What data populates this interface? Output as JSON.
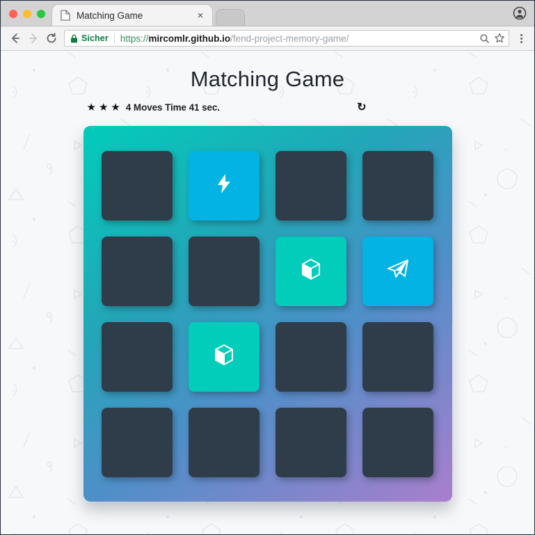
{
  "browser": {
    "traffic_lights": [
      "close",
      "minimize",
      "zoom"
    ],
    "tab": {
      "title": "Matching Game",
      "favicon": "page-icon",
      "close_label": "×"
    },
    "toolbar": {
      "back": "←",
      "forward": "→",
      "reload": "C",
      "security_label": "Sicher",
      "url_scheme": "https://",
      "url_host": "mircomlr.github.io",
      "url_path": "/fend-project-memory-game/",
      "zoom_icon": "search-icon",
      "bookmark_icon": "star-icon",
      "menu_icon": "three-dot-menu-icon",
      "profile_icon": "account-avatar-icon"
    }
  },
  "page": {
    "title": "Matching Game",
    "score": {
      "stars": 3,
      "star_glyph": "★",
      "moves_text": "4 Moves Time 41 sec.",
      "moves": 4,
      "time_seconds": 41,
      "restart_glyph": "↻",
      "restart_label": "restart-button"
    },
    "board": {
      "rows": 4,
      "columns": 4,
      "colors": {
        "card_back": "#2e3d49",
        "card_open": "#02b3e4",
        "card_match": "#02ccba",
        "deck_gradient_start": "#02ccba",
        "deck_gradient_mid": "#4e8fc9",
        "deck_gradient_end": "#aa7ecd"
      },
      "cards": [
        {
          "state": "closed",
          "icon": ""
        },
        {
          "state": "open",
          "icon": "bolt-icon"
        },
        {
          "state": "closed",
          "icon": ""
        },
        {
          "state": "closed",
          "icon": ""
        },
        {
          "state": "closed",
          "icon": ""
        },
        {
          "state": "closed",
          "icon": ""
        },
        {
          "state": "match",
          "icon": "cube-icon"
        },
        {
          "state": "open",
          "icon": "paper-plane-icon"
        },
        {
          "state": "closed",
          "icon": ""
        },
        {
          "state": "match",
          "icon": "cube-icon"
        },
        {
          "state": "closed",
          "icon": ""
        },
        {
          "state": "closed",
          "icon": ""
        },
        {
          "state": "closed",
          "icon": ""
        },
        {
          "state": "closed",
          "icon": ""
        },
        {
          "state": "closed",
          "icon": ""
        },
        {
          "state": "closed",
          "icon": ""
        }
      ]
    }
  }
}
